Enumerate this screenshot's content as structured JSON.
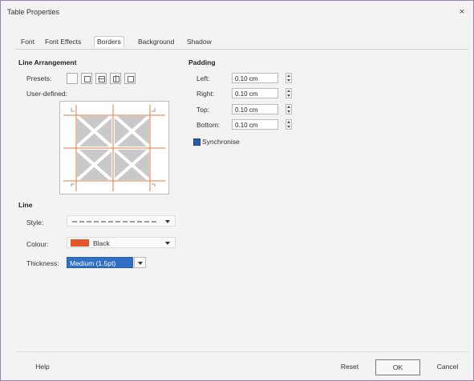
{
  "window": {
    "title": "Table Properties",
    "close_glyph": "×"
  },
  "tabs": [
    {
      "label": "Font",
      "active": false
    },
    {
      "label": "Font Effects",
      "active": false
    },
    {
      "label": "Borders",
      "active": true
    },
    {
      "label": "Background",
      "active": false
    },
    {
      "label": "Shadow",
      "active": false
    }
  ],
  "line_arrangement": {
    "heading": "Line Arrangement",
    "presets_label": "Presets:",
    "user_defined_label": "User-defined:",
    "preset_icons": [
      "border-none-icon",
      "border-box-icon",
      "border-box-horizontal-icon",
      "border-box-vertical-icon",
      "border-outer-only-icon"
    ]
  },
  "padding": {
    "heading": "Padding",
    "fields": [
      {
        "label": "Left:",
        "value": "0.10 cm"
      },
      {
        "label": "Right:",
        "value": "0.10 cm"
      },
      {
        "label": "Top:",
        "value": "0.10 cm"
      },
      {
        "label": "Bottom:",
        "value": "0.10 cm"
      }
    ],
    "synchronize_label": "Synchronise",
    "synchronize_checked": true
  },
  "line": {
    "heading": "Line",
    "style_label": "Style:",
    "colour_label": "Colour:",
    "colour_value": "Black",
    "colour_swatch": "#e45528",
    "thickness_label": "Thickness:",
    "thickness_value": "Medium (1.5pt)"
  },
  "buttons": {
    "help": "Help",
    "reset": "Reset",
    "ok": "OK",
    "cancel": "Cancel"
  }
}
